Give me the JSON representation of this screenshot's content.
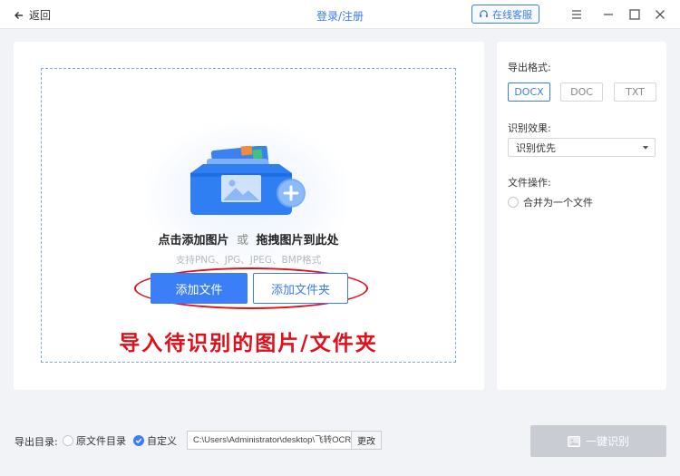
{
  "titlebar": {
    "back_label": "返回",
    "login_label": "登录/注册",
    "service_label": "在线客服"
  },
  "upload": {
    "hint_add": "点击添加图片",
    "hint_or": "或",
    "hint_drag": "拖拽图片到此处",
    "formats": "支持PNG、JPG、JPEG、BMP格式",
    "add_file_label": "添加文件",
    "add_folder_label": "添加文件夹",
    "annotation": "导入待识别的图片/文件夹"
  },
  "settings": {
    "export_format_label": "导出格式:",
    "formats": [
      "DOCX",
      "DOC",
      "TXT"
    ],
    "selected_format": "DOCX",
    "effect_label": "识别效果:",
    "effect_value": "识别优先",
    "file_op_label": "文件操作:",
    "merge_label": "合并为一个文件",
    "merge_checked": false
  },
  "bottom": {
    "export_dir_label": "导出目录:",
    "option_original": "原文件目录",
    "option_custom": "自定义",
    "selected_option": "custom",
    "path_value": "C:\\Users\\Administrator\\desktop\\飞转OCR文",
    "change_label": "更改",
    "recognize_label": "一键识别"
  },
  "colors": {
    "accent": "#3a7bf0",
    "annotation_red": "#e0101a",
    "disabled": "#c9ccd2"
  }
}
